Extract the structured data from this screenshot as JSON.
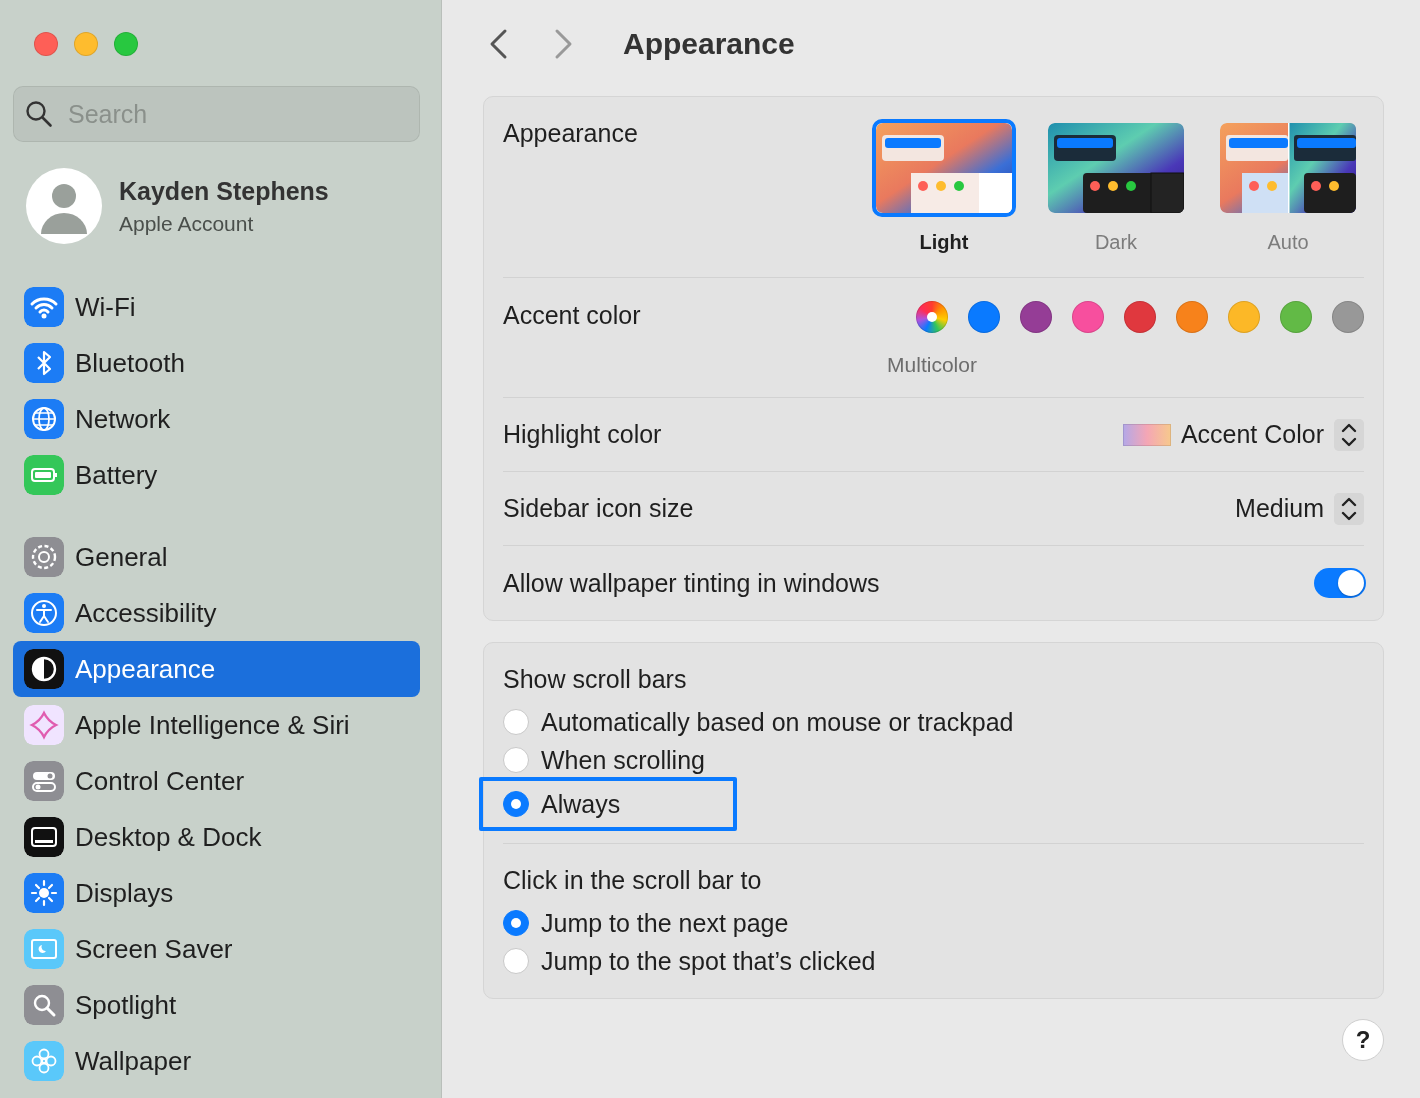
{
  "sidebar": {
    "search": {
      "placeholder": "Search"
    },
    "account": {
      "name": "Kayden Stephens",
      "subtitle": "Apple Account"
    },
    "groups": [
      [
        {
          "label": "Wi-Fi",
          "kind": "wifi",
          "selected": false
        },
        {
          "label": "Bluetooth",
          "kind": "bluetooth",
          "selected": false
        },
        {
          "label": "Network",
          "kind": "network",
          "selected": false
        },
        {
          "label": "Battery",
          "kind": "battery",
          "selected": false
        }
      ],
      [
        {
          "label": "General",
          "kind": "general",
          "selected": false
        },
        {
          "label": "Accessibility",
          "kind": "accessibility",
          "selected": false
        },
        {
          "label": "Appearance",
          "kind": "appearance",
          "selected": true
        },
        {
          "label": "Apple Intelligence & Siri",
          "kind": "siri",
          "selected": false
        },
        {
          "label": "Control Center",
          "kind": "control",
          "selected": false
        },
        {
          "label": "Desktop & Dock",
          "kind": "desktop",
          "selected": false
        },
        {
          "label": "Displays",
          "kind": "displays",
          "selected": false
        },
        {
          "label": "Screen Saver",
          "kind": "screensaver",
          "selected": false
        },
        {
          "label": "Spotlight",
          "kind": "spotlight",
          "selected": false
        },
        {
          "label": "Wallpaper",
          "kind": "wallpaper",
          "selected": false
        }
      ]
    ]
  },
  "content": {
    "title": "Appearance",
    "appearance": {
      "label": "Appearance",
      "themes": [
        {
          "label": "Light",
          "kind": "light",
          "selected": true
        },
        {
          "label": "Dark",
          "kind": "dark",
          "selected": false
        },
        {
          "label": "Auto",
          "kind": "auto",
          "selected": false
        }
      ]
    },
    "accent_color": {
      "label": "Accent color",
      "caption": "Multicolor",
      "colors": [
        {
          "kind": "multicolor",
          "selected": true
        },
        {
          "kind": "solid",
          "color": "#0a7aff",
          "selected": false
        },
        {
          "kind": "solid",
          "color": "#953d96",
          "selected": false
        },
        {
          "kind": "solid",
          "color": "#f74f9e",
          "selected": false
        },
        {
          "kind": "solid",
          "color": "#e0383e",
          "selected": false
        },
        {
          "kind": "solid",
          "color": "#f7821b",
          "selected": false
        },
        {
          "kind": "solid",
          "color": "#fcb827",
          "selected": false
        },
        {
          "kind": "solid",
          "color": "#62ba46",
          "selected": false
        },
        {
          "kind": "solid",
          "color": "#989898",
          "selected": false
        }
      ]
    },
    "highlight_color": {
      "label": "Highlight color",
      "value": "Accent Color"
    },
    "sidebar_icon_size": {
      "label": "Sidebar icon size",
      "value": "Medium"
    },
    "wallpaper_tinting": {
      "label": "Allow wallpaper tinting in windows",
      "on": true
    },
    "scroll_bars": {
      "label": "Show scroll bars",
      "options": [
        {
          "label": "Automatically based on mouse or trackpad",
          "selected": false,
          "highlighted": false
        },
        {
          "label": "When scrolling",
          "selected": false,
          "highlighted": false
        },
        {
          "label": "Always",
          "selected": true,
          "highlighted": true
        }
      ]
    },
    "click_scroll_bar": {
      "label": "Click in the scroll bar to",
      "options": [
        {
          "label": "Jump to the next page",
          "selected": true,
          "highlighted": false
        },
        {
          "label": "Jump to the spot that’s clicked",
          "selected": false,
          "highlighted": false
        }
      ]
    },
    "help": {
      "label": "?"
    }
  }
}
